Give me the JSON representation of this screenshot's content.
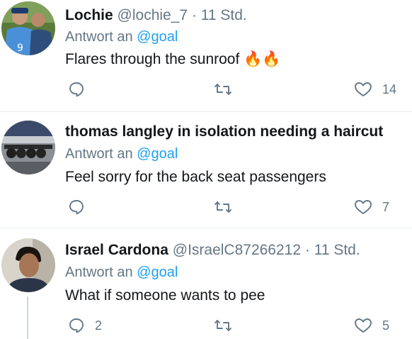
{
  "tweets": [
    {
      "name": "Lochie",
      "handle": "@lochie_7",
      "time": "· 11 Std.",
      "reply_prefix": "Antwort an",
      "reply_to": "@goal",
      "text": "Flares through the sunroof",
      "emoji": "🔥🔥",
      "reply_count": "",
      "retweet_count": "",
      "like_count": "14"
    },
    {
      "name": "thomas langley in isolation needing a haircut",
      "handle": "",
      "time": "",
      "reply_prefix": "Antwort an",
      "reply_to": "@goal",
      "text": "Feel sorry for the back seat passengers",
      "reply_count": "",
      "retweet_count": "",
      "like_count": "7"
    },
    {
      "name": "Israel Cardona",
      "handle": "@IsraelC87266212",
      "time": "· 11 Std.",
      "reply_prefix": "Antwort an",
      "reply_to": "@goal",
      "text": "What if someone wants to pee",
      "reply_count": "2",
      "retweet_count": "",
      "like_count": "5"
    }
  ],
  "colors": {
    "text": "#14171a",
    "secondary": "#657786",
    "link": "#1da1f2",
    "divider": "#e6ecf0"
  },
  "icons": [
    "reply-icon",
    "retweet-icon",
    "like-icon",
    "fire-emoji"
  ]
}
